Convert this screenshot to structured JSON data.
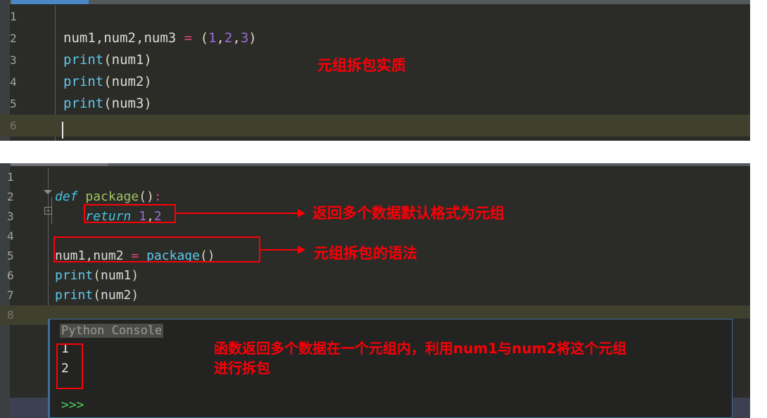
{
  "editor1": {
    "tab_accent_color": "#4a88c7",
    "lines": [
      {
        "num": "1",
        "tokens": []
      },
      {
        "num": "2",
        "tokens": [
          {
            "t": "num1",
            "c": "t-id"
          },
          {
            "t": ",",
            "c": "t-punct"
          },
          {
            "t": "num2",
            "c": "t-id"
          },
          {
            "t": ",",
            "c": "t-punct"
          },
          {
            "t": "num3",
            "c": "t-id"
          },
          {
            "t": " ",
            "c": "t-punct"
          },
          {
            "t": "=",
            "c": "t-eq"
          },
          {
            "t": " ",
            "c": "t-punct"
          },
          {
            "t": "(",
            "c": "t-paren"
          },
          {
            "t": "1",
            "c": "t-num"
          },
          {
            "t": ",",
            "c": "t-punct"
          },
          {
            "t": "2",
            "c": "t-num"
          },
          {
            "t": ",",
            "c": "t-punct"
          },
          {
            "t": "3",
            "c": "t-num"
          },
          {
            "t": ")",
            "c": "t-paren"
          }
        ]
      },
      {
        "num": "3",
        "tokens": [
          {
            "t": "print",
            "c": "t-fn"
          },
          {
            "t": "(",
            "c": "t-paren"
          },
          {
            "t": "num1",
            "c": "t-id"
          },
          {
            "t": ")",
            "c": "t-paren"
          }
        ]
      },
      {
        "num": "4",
        "tokens": [
          {
            "t": "print",
            "c": "t-fn"
          },
          {
            "t": "(",
            "c": "t-paren"
          },
          {
            "t": "num2",
            "c": "t-id"
          },
          {
            "t": ")",
            "c": "t-paren"
          }
        ]
      },
      {
        "num": "5",
        "tokens": [
          {
            "t": "print",
            "c": "t-fn"
          },
          {
            "t": "(",
            "c": "t-paren"
          },
          {
            "t": "num3",
            "c": "t-id"
          },
          {
            "t": ")",
            "c": "t-paren"
          }
        ]
      },
      {
        "num": "6",
        "tokens": [],
        "current": true
      }
    ],
    "annotation": "元组拆包实质"
  },
  "editor2": {
    "lines": [
      {
        "num": "1",
        "tokens": []
      },
      {
        "num": "2",
        "tokens": [
          {
            "t": "def",
            "c": "t-kw"
          },
          {
            "t": " ",
            "c": "t-punct"
          },
          {
            "t": "package",
            "c": "t-def"
          },
          {
            "t": "(",
            "c": "t-paren"
          },
          {
            "t": ")",
            "c": "t-paren"
          },
          {
            "t": ":",
            "c": "t-colon"
          }
        ]
      },
      {
        "num": "3",
        "tokens": [
          {
            "t": "    ",
            "c": "t-punct"
          },
          {
            "t": "return",
            "c": "t-kw"
          },
          {
            "t": " ",
            "c": "t-punct"
          },
          {
            "t": "1",
            "c": "t-num"
          },
          {
            "t": ",",
            "c": "t-punct"
          },
          {
            "t": "2",
            "c": "t-num"
          }
        ]
      },
      {
        "num": "4",
        "tokens": []
      },
      {
        "num": "5",
        "tokens": [
          {
            "t": "num1",
            "c": "t-id"
          },
          {
            "t": ",",
            "c": "t-punct"
          },
          {
            "t": "num2",
            "c": "t-id"
          },
          {
            "t": " ",
            "c": "t-punct"
          },
          {
            "t": "=",
            "c": "t-eq"
          },
          {
            "t": " ",
            "c": "t-punct"
          },
          {
            "t": "package",
            "c": "t-fn"
          },
          {
            "t": "(",
            "c": "t-paren"
          },
          {
            "t": ")",
            "c": "t-paren"
          }
        ]
      },
      {
        "num": "6",
        "tokens": [
          {
            "t": "print",
            "c": "t-fn"
          },
          {
            "t": "(",
            "c": "t-paren"
          },
          {
            "t": "num1",
            "c": "t-id"
          },
          {
            "t": ")",
            "c": "t-paren"
          }
        ]
      },
      {
        "num": "7",
        "tokens": [
          {
            "t": "print",
            "c": "t-fn"
          },
          {
            "t": "(",
            "c": "t-paren"
          },
          {
            "t": "num2",
            "c": "t-id"
          },
          {
            "t": ")",
            "c": "t-paren"
          }
        ]
      },
      {
        "num": "8",
        "tokens": [],
        "current": true
      }
    ],
    "annotation_return": "返回多个数据默认格式为元组",
    "annotation_unpack": "元组拆包的语法"
  },
  "console": {
    "title": "Python Console",
    "output_lines": [
      "1",
      "2"
    ],
    "prompt": ">>>",
    "annotation": "函数返回多个数据在一个元组内，利用num1与num2将这个元组\n进行拆包"
  },
  "colors": {
    "annotation_red": "#fb0007",
    "editor_bg": "#2b2b28",
    "console_bg": "#232322",
    "console_border": "#3f6d9e",
    "tab_accent": "#4a88c7",
    "current_line": "#40402f"
  }
}
